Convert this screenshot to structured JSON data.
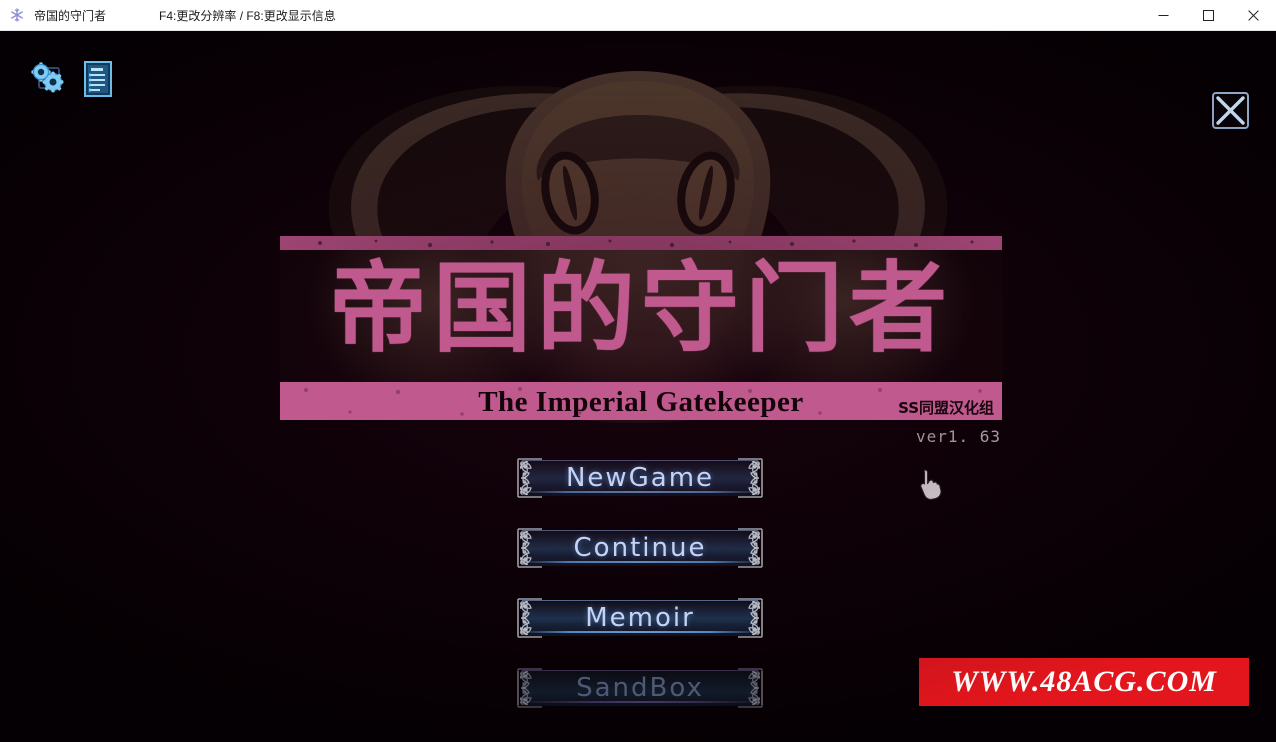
{
  "window": {
    "title": "帝国的守门者",
    "hint": "F4:更改分辨率 / F8:更改显示信息",
    "app_icon": "snowflake-icon",
    "controls": {
      "minimize": "minimize-icon",
      "maximize": "maximize-icon",
      "close": "close-icon"
    }
  },
  "hud": {
    "settings_icon": "gears-settings-icon",
    "log_icon": "document-log-icon",
    "close_icon": "close-x-icon"
  },
  "logo": {
    "title_cn": "帝国的守门者",
    "title_en": "The Imperial Gatekeeper",
    "group_credit": "SS同盟汉化组",
    "accent_color": "#c0598d",
    "panel_color": "#0d0306"
  },
  "version": "ver1. 63",
  "menu": {
    "items": [
      {
        "label": "NewGame",
        "enabled": true
      },
      {
        "label": "Continue",
        "enabled": true
      },
      {
        "label": "Memoir",
        "enabled": true
      },
      {
        "label": "SandBox",
        "enabled": false
      }
    ]
  },
  "watermark": {
    "text": "WWW.48ACG.COM",
    "background": "#e2161c",
    "text_color": "#ffffff"
  },
  "cursor": {
    "type": "pointing-hand"
  },
  "theme": {
    "canvas_background": "#050003",
    "titlebar_background": "#ffffff",
    "button_text": "#c3d3f7",
    "button_disabled_text": "#4e5a73"
  }
}
